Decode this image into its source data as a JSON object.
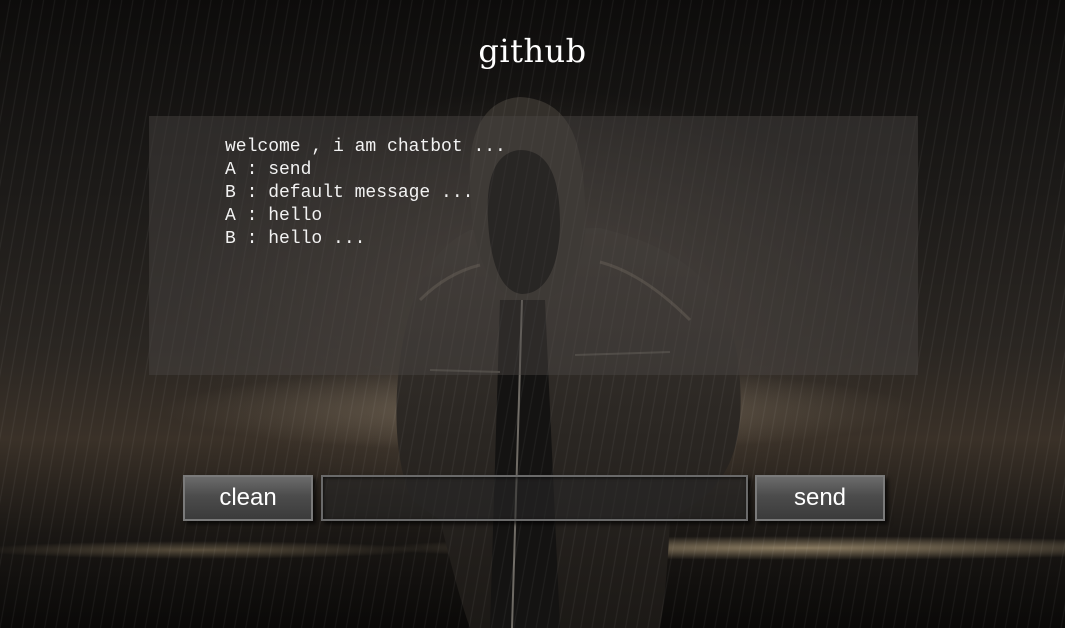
{
  "header": {
    "title": "github"
  },
  "chat": {
    "messages": [
      "welcome , i am chatbot ...",
      "A : send",
      "B : default message ...",
      "A : hello",
      "B : hello ..."
    ]
  },
  "controls": {
    "clean_label": "clean",
    "send_label": "send",
    "input_value": "",
    "input_placeholder": ""
  },
  "colors": {
    "text": "#ffffff",
    "button_top": "#6b6b6b",
    "button_bottom": "#3b3b3b",
    "button_border": "#7a7a7a",
    "panel": "rgba(75,72,68,0.45)"
  }
}
